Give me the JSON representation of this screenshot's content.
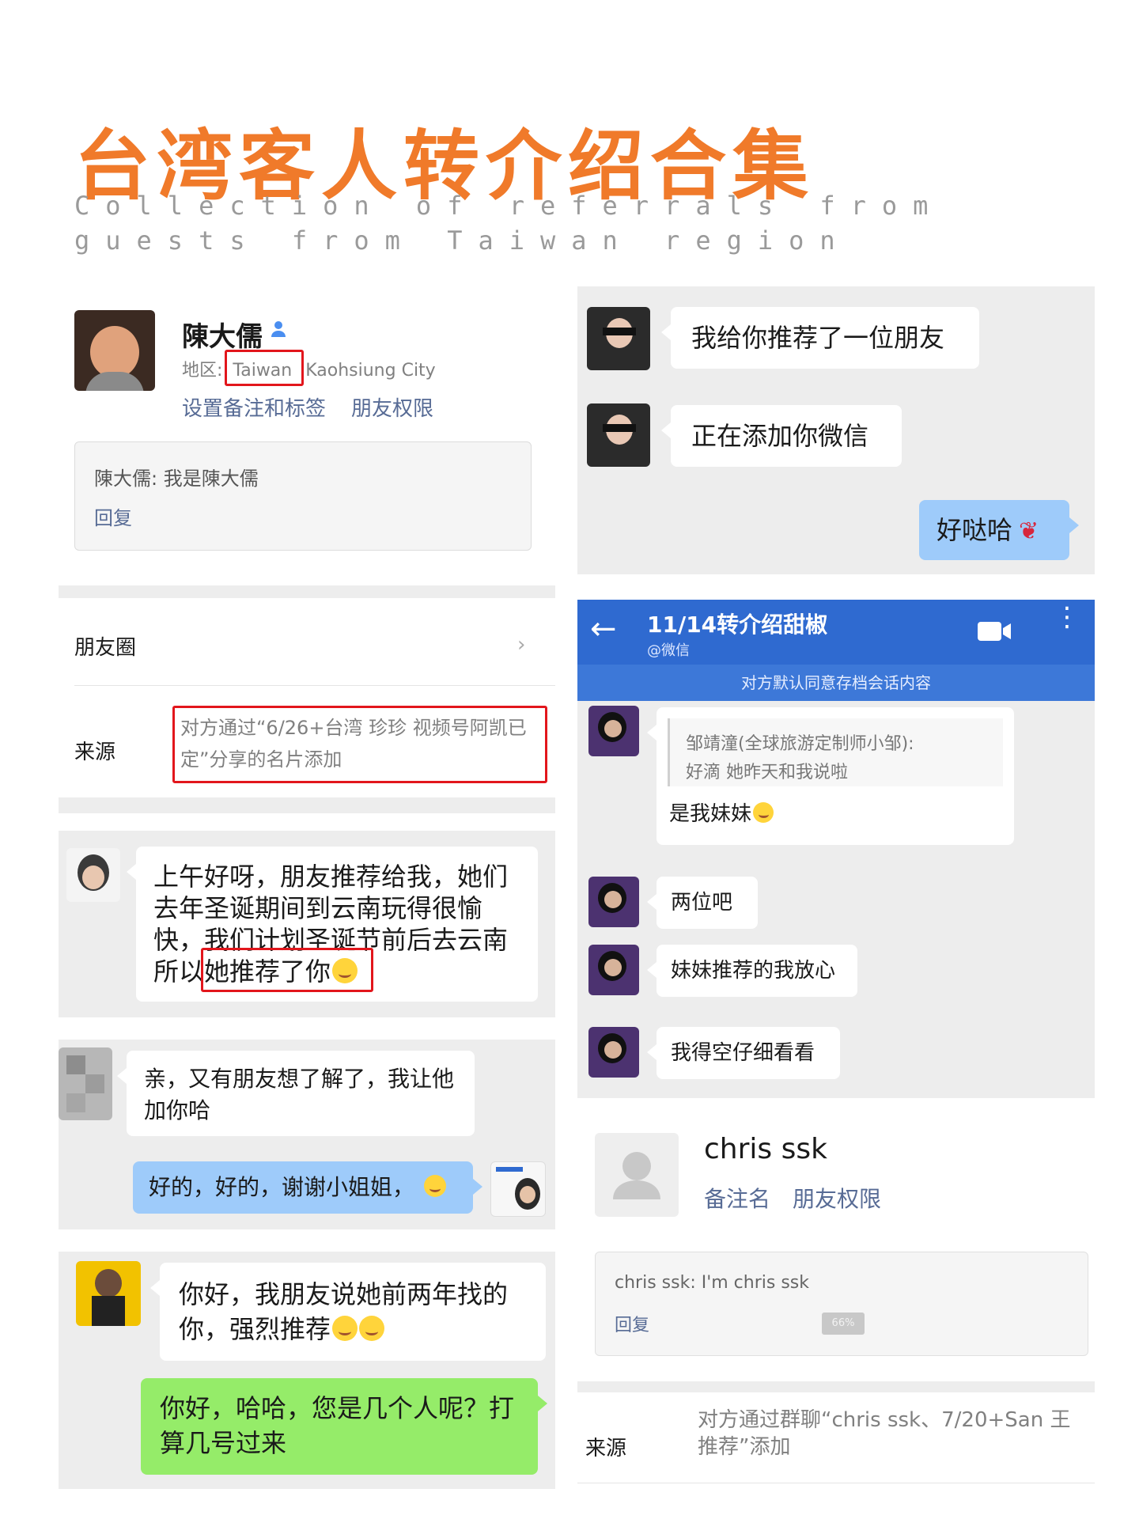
{
  "header": {
    "title": "台湾客人转介绍合集",
    "subtitle": "Collection of referrals from guests from Taiwan region"
  },
  "profile1": {
    "name": "陳大儒",
    "region_label": "地区:",
    "region_country": "Taiwan",
    "region_city": "Kaohsiung City",
    "link_remark": "设置备注和标签",
    "link_permission": "朋友权限",
    "greeting": "陳大儒: 我是陳大儒",
    "reply": "回复",
    "moments_label": "朋友圈",
    "source_label": "来源",
    "source_text": "对方通过“6/26+台湾 珍珍 视频号阿凯已定”分享的名片添加"
  },
  "chat_a": {
    "message": "上午好呀，朋友推荐给我，她们去年圣诞期间到云南玩得很愉快，我们计划圣诞节前后去云南所以她推荐了你"
  },
  "chat_b": {
    "incoming": "亲，又有朋友想了解了，我让他加你哈",
    "outgoing": "好的，好的，谢谢小姐姐，"
  },
  "chat_c": {
    "incoming": "你好，我朋友说她前两年找的你，强烈推荐",
    "outgoing": "你好，哈哈，您是几个人呢？打算几号过来"
  },
  "chat_d": {
    "msg1": "我给你推荐了一位朋友",
    "msg2": "正在添加你微信",
    "reply": "好哒哈"
  },
  "chat_e": {
    "title": "11/14转介绍甜椒",
    "subtitle": "@微信",
    "notice": "对方默认同意存档会话内容",
    "quote_author": "邹靖潼(全球旅游定制师小邹):",
    "quote_text": "好滴 她昨天和我说啦",
    "reply": "是我妹妹",
    "msg2": "两位吧",
    "msg3": "妹妹推荐的我放心",
    "msg4": "我得空仔细看看"
  },
  "profile2": {
    "name": "chris ssk",
    "link_remark": "备注名",
    "link_permission": "朋友权限",
    "greeting": "chris ssk: I'm chris ssk",
    "reply": "回复",
    "badge": "66%",
    "source_label": "来源",
    "source_text": "对方通过群聊“chris ssk、7/20+San 王推荐”添加"
  },
  "colors": {
    "accent": "#f07a2a",
    "highlight": "#e2161c",
    "link": "#576b95",
    "wecom_blue": "#2f6ad0",
    "wechat_green": "#95ec69"
  }
}
